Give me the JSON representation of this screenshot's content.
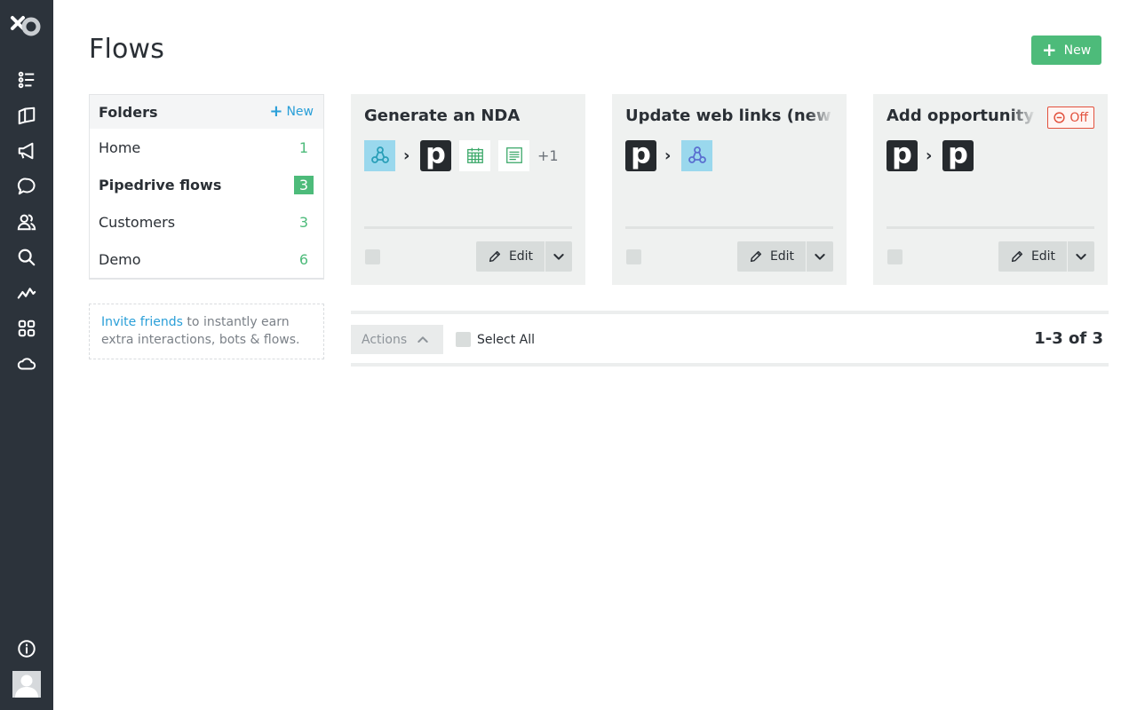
{
  "header": {
    "title": "Flows",
    "new_button_label": "New"
  },
  "nav": {
    "items": [
      "tasks-icon",
      "book-icon",
      "megaphone-icon",
      "chat-icon",
      "contacts-icon",
      "search-icon",
      "analytics-icon",
      "apps-icon",
      "cloud-icon"
    ],
    "bottom": [
      "info-icon",
      "avatar"
    ]
  },
  "folders": {
    "title": "Folders",
    "new_label": "New",
    "items": [
      {
        "name": "Home",
        "count": "1"
      },
      {
        "name": "Pipedrive flows",
        "count": "3",
        "active": true
      },
      {
        "name": "Customers",
        "count": "3"
      },
      {
        "name": "Demo",
        "count": "6"
      }
    ]
  },
  "invite": {
    "link": "Invite friends",
    "text": " to instantly earn extra interactions, bots & flows."
  },
  "flows": [
    {
      "title": "Generate an NDA",
      "apps": [
        "webhook-icon",
        "pipedrive-icon",
        "google-calendar-icon",
        "google-docs-icon"
      ],
      "more": "+1",
      "status": "",
      "edit_label": "Edit"
    },
    {
      "title": "Update web links (new or",
      "apps": [
        "pipedrive-icon",
        "webhook-icon"
      ],
      "more": "",
      "status": "",
      "edit_label": "Edit"
    },
    {
      "title": "Add opportunity for",
      "apps": [
        "pipedrive-icon",
        "pipedrive-icon"
      ],
      "more": "",
      "status": "Off",
      "edit_label": "Edit"
    }
  ],
  "actions": {
    "label": "Actions",
    "select_all": "Select All",
    "pagination": "1-3 of 3"
  },
  "colors": {
    "sidebar": "#2c333b",
    "accent_green": "#4dbb7a",
    "link_blue": "#2a9fd8",
    "off_red": "#e2513d"
  }
}
